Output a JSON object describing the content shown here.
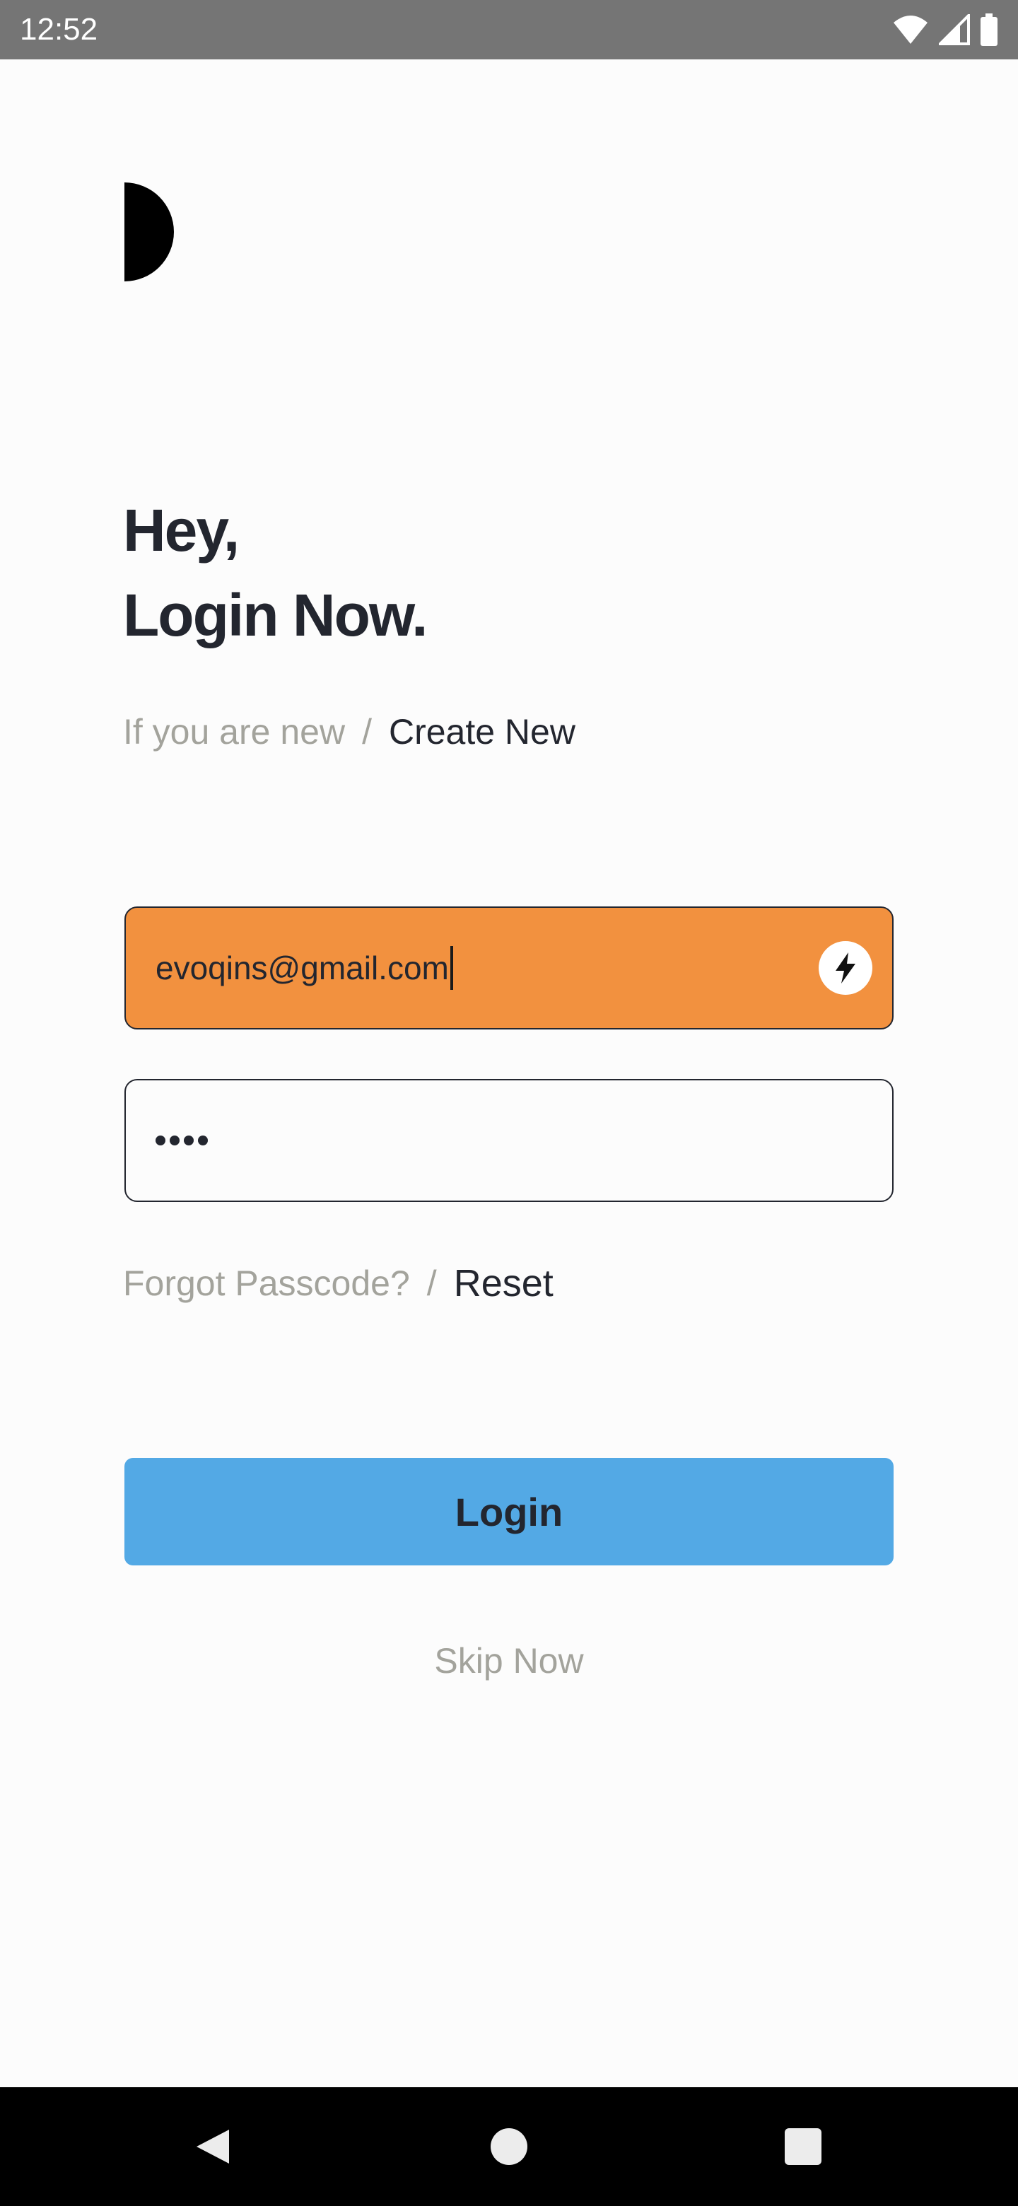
{
  "status_bar": {
    "time": "12:52"
  },
  "header": {
    "title_line1": "Hey,",
    "title_line2": "Login Now."
  },
  "signup": {
    "prompt": "If you are new",
    "separator": "/",
    "link": "Create New"
  },
  "email_field": {
    "value": "evoqins@gmail.com",
    "background": "#f2913f",
    "icon": "lightning-icon"
  },
  "password_field": {
    "masked_value": "••••"
  },
  "reset": {
    "prompt": "Forgot Passcode?",
    "separator": "/",
    "link": "Reset"
  },
  "login_button": {
    "label": "Login",
    "color": "#53a9e5"
  },
  "skip": {
    "label": "Skip Now"
  },
  "colors": {
    "text_dark": "#23262f",
    "text_muted": "#a3a39c",
    "status_bar": "#757575",
    "nav_bar": "#000000"
  }
}
